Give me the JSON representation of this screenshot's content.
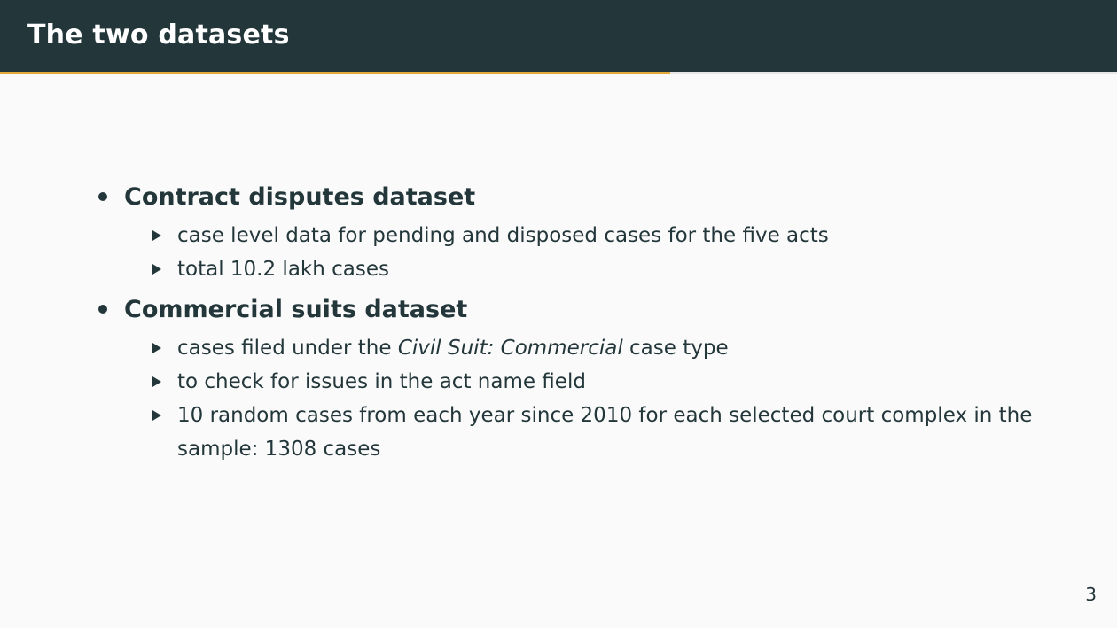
{
  "slide": {
    "title": "The two datasets",
    "page_number": "3",
    "progress_fraction": 0.6
  },
  "sections": [
    {
      "heading": "Contract disputes dataset",
      "items": [
        "case level data for pending and disposed cases for the five acts",
        "total 10.2 lakh cases"
      ]
    },
    {
      "heading": "Commercial suits dataset",
      "items": [
        {
          "prefix": "cases filed under the ",
          "emphasis": "Civil Suit: Commercial",
          "suffix": " case type"
        },
        "to check for issues in the act name field",
        "10 random cases from each year since 2010 for each selected court complex in the sample: 1308 cases"
      ]
    }
  ],
  "colors": {
    "title_bar": "#23373b",
    "background": "#fafafa",
    "progress_accent": "#e5a93a",
    "text": "#23373b"
  }
}
